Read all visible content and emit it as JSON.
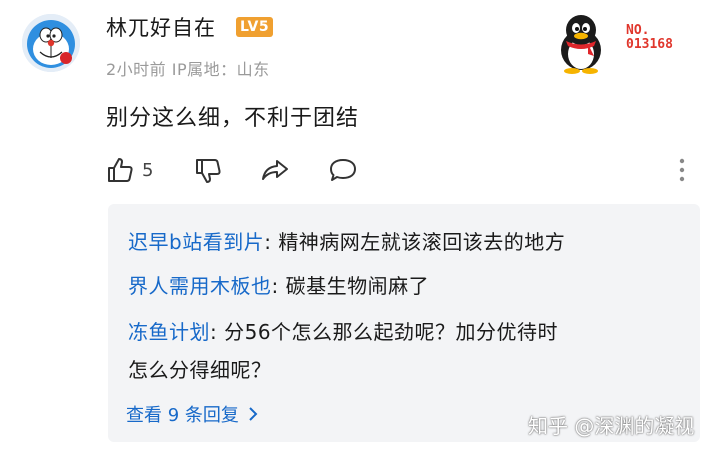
{
  "comment": {
    "username": "林兀好自在",
    "level_badge": "LV5",
    "meta": "2小时前 IP属地：山东",
    "badge_number_prefix": "NO.",
    "badge_number": "013168",
    "text": "别分这么细，不利于团结",
    "likes": "5"
  },
  "actions": {
    "icons": [
      "thumbs-up-icon",
      "thumbs-down-icon",
      "share-icon",
      "comment-icon",
      "more-vertical-icon"
    ]
  },
  "replies": [
    {
      "author": "迟早b站看到片",
      "sep": ": ",
      "text": "精神病网左就该滚回该去的地方"
    },
    {
      "author": "界人需用木板也",
      "sep": ": ",
      "text": "碳基生物闹麻了"
    },
    {
      "author": "冻鱼计划",
      "sep": ": ",
      "text": "分56个怎么那么起劲呢？加分优待时",
      "text2": "怎么分得细呢？"
    }
  ],
  "view_more": "查看 9 条回复",
  "watermark": "知乎 @深渊的凝视",
  "colors": {
    "link": "#1769c9",
    "level": "#f0a030",
    "badge": "#e0362c",
    "reply_bg": "#f3f4f6"
  }
}
